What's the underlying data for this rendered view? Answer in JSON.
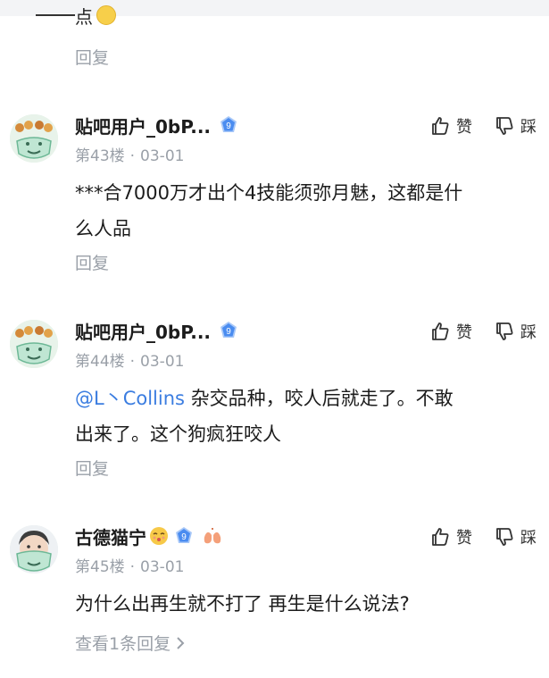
{
  "top": {
    "fragment_text": "点",
    "reply_label": "回复"
  },
  "comments": [
    {
      "username": "贴吧用户_0bP...",
      "badge_level": "9",
      "floor": "第43楼",
      "date": "03-01",
      "like_label": "赞",
      "dislike_label": "踩",
      "content_lines": [
        "***合7000万才出个4技能须弥月魅，这都是什",
        "么人品"
      ],
      "reply_label": "回复"
    },
    {
      "username": "贴吧用户_0bP...",
      "badge_level": "9",
      "floor": "第44楼",
      "date": "03-01",
      "like_label": "赞",
      "dislike_label": "踩",
      "mention": "@L丶Collins",
      "content_lines": [
        " 杂交品种，咬人后就走了。不敢",
        "出来了。这个狗疯狂咬人"
      ],
      "reply_label": "回复"
    },
    {
      "username": "古德猫宁",
      "badge_level": "9",
      "floor": "第45楼",
      "date": "03-01",
      "like_label": "赞",
      "dislike_label": "踩",
      "content_lines": [
        "为什么出再生就不打了 再生是什么说法?"
      ],
      "view_replies_label": "查看1条回复"
    }
  ],
  "separator": "·",
  "colors": {
    "mention": "#3b7de0",
    "meta_gray": "#9aa0a8",
    "badge_blue": "#4a8cf0"
  }
}
